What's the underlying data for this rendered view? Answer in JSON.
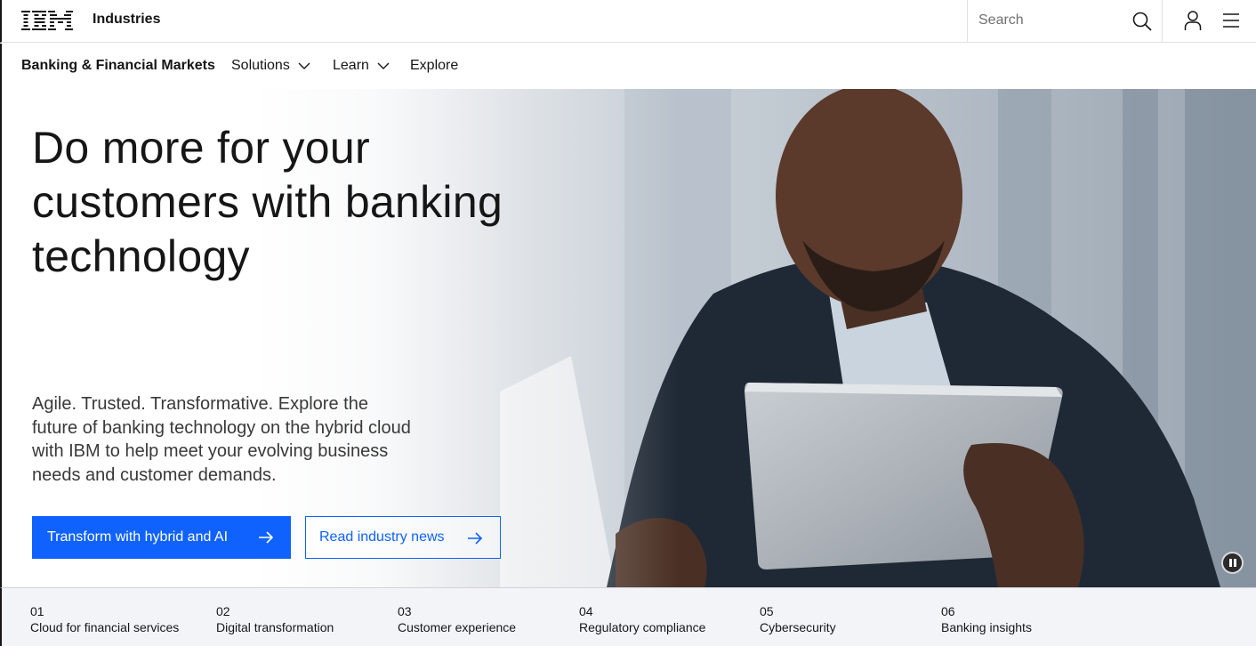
{
  "masthead": {
    "logo_text": "IBM",
    "brand": "Industries",
    "search_placeholder": "Search",
    "icons": [
      "search-icon",
      "user-icon",
      "menu-icon"
    ]
  },
  "l1_nav": {
    "title": "Banking & Financial Markets",
    "items": [
      {
        "label": "Solutions",
        "has_dropdown": true
      },
      {
        "label": "Learn",
        "has_dropdown": true
      },
      {
        "label": "Explore",
        "has_dropdown": false
      }
    ]
  },
  "hero": {
    "title": "Do more for your customers with banking technology",
    "description": "Agile. Trusted. Transformative. Explore the future of banking technology on the hybrid cloud with IBM to help meet your evolving business needs and customer demands.",
    "primary_cta": "Transform with hybrid and AI",
    "secondary_cta": "Read industry news",
    "video_control": "pause"
  },
  "toc": [
    {
      "num": "01",
      "label": "Cloud for financial services"
    },
    {
      "num": "02",
      "label": "Digital transformation"
    },
    {
      "num": "03",
      "label": "Customer experience"
    },
    {
      "num": "04",
      "label": "Regulatory compliance"
    },
    {
      "num": "05",
      "label": "Cybersecurity"
    },
    {
      "num": "06",
      "label": "Banking insights"
    }
  ],
  "colors": {
    "primary": "#0f62fe",
    "text": "#161616",
    "toc_bg": "#f2f4f8"
  }
}
